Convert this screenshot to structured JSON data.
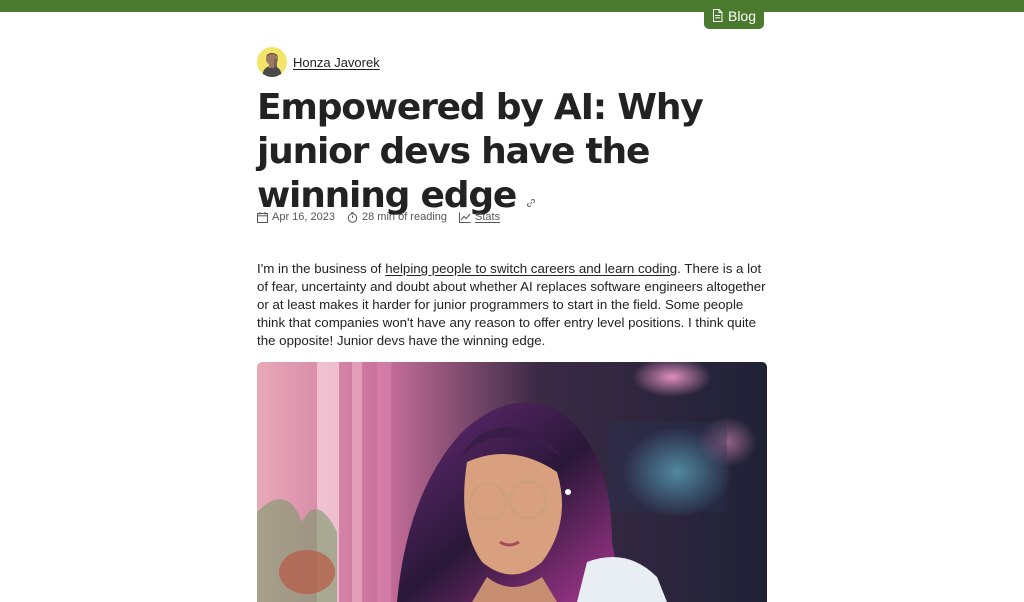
{
  "nav": {
    "blog_label": "Blog",
    "blog_icon": "document-icon"
  },
  "colors": {
    "brand_green": "#4a7a2e",
    "text": "#222222",
    "meta_text": "#555555"
  },
  "author": {
    "name": "Honza Javorek"
  },
  "article": {
    "title": "Empowered by AI: Why junior devs have the winning edge",
    "date": "Apr 16, 2023",
    "reading_time": "28 min of reading",
    "stats_label": "Stats",
    "intro_before_link": "I'm in the business of ",
    "intro_link": "helping people to switch careers and learn coding",
    "intro_after_link": ". There is a lot of fear, uncertainty and doubt about whether AI replaces software engineers altogether or at least makes it harder for junior programmers to start in the field. Some people think that companies won't have any reason to offer entry level positions. I think quite the opposite! Junior devs have the winning edge."
  }
}
